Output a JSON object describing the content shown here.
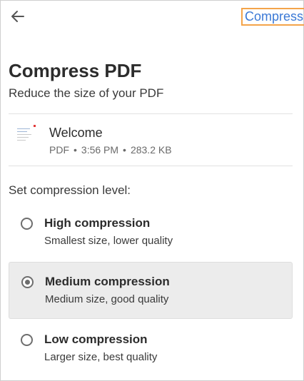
{
  "header": {
    "action_label": "Compress"
  },
  "title": "Compress PDF",
  "subtitle": "Reduce the size of your PDF",
  "file": {
    "name": "Welcome",
    "type": "PDF",
    "time": "3:56 PM",
    "size": "283.2 KB",
    "separator": "•"
  },
  "section_label": "Set compression level:",
  "options": [
    {
      "title": "High compression",
      "description": "Smallest size, lower quality",
      "selected": false
    },
    {
      "title": "Medium compression",
      "description": "Medium size, good quality",
      "selected": true
    },
    {
      "title": "Low compression",
      "description": "Larger size, best quality",
      "selected": false
    }
  ],
  "icons": {
    "back": "arrow-left-icon",
    "file": "pdf-thumbnail-icon"
  },
  "colors": {
    "accent": "#3b79d6",
    "focus_ring": "#f4a44a",
    "selected_bg": "#ececec"
  }
}
